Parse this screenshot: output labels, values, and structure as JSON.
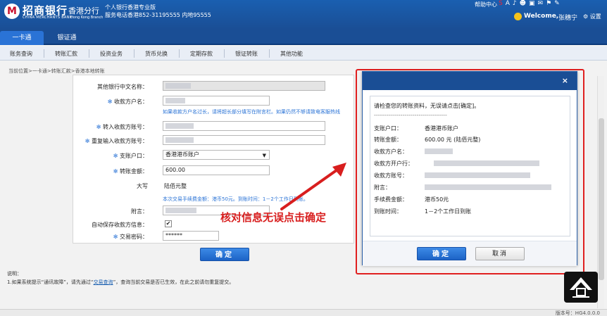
{
  "header": {
    "logo_glyph": "M",
    "bank_name": "招商银行",
    "branch": "香港分行",
    "bank_en": "CHINA MERCHANTS BANK",
    "branch_en": "Hong Kong Branch",
    "product": "个人银行香港专业版",
    "hotline": "服务电话香港852-31195555 内地95555",
    "help": "帮助中心",
    "tool_icons": [
      "S",
      "A",
      "♪",
      "☻",
      "▣",
      "✉",
      "⚑",
      "✎"
    ],
    "welcome": "Welcome,",
    "username": "张穗宁",
    "settings": "⚙ 设置"
  },
  "nav": {
    "tabs": [
      {
        "label": "一卡通",
        "active": true
      },
      {
        "label": "银证通",
        "active": false
      }
    ]
  },
  "subnav": {
    "items": [
      "账务查询",
      "转账汇款",
      "投资业务",
      "货币兑换",
      "定期存款",
      "银证转账",
      "其他功能"
    ]
  },
  "breadcrumb": "当前位置>一卡通>转账汇款>香港本地转账",
  "form": {
    "other_bank_name_label": "其他银行中文名称：",
    "payee_name_label": "收款方户名：",
    "payee_hint": "如果收款方户名过长，请将超长部分填写在附言栏。如果仍然不够请致电客服热线",
    "payee_account_label": "转入收款方账号：",
    "repeat_account_label": "重复输入收款方账号：",
    "from_account_label": "支账户口：",
    "from_account_value": "香港港币账户",
    "amount_label": "转账金额：",
    "amount_value": "600.00",
    "uppercase_label": "大写",
    "uppercase_value": "陆佰元整",
    "fee_hint": "本次交易手续费金额：港币50元。到账时间：1－2个工作日到账。",
    "remark_label": "附言：",
    "autosave_label": "自动保存收款方信息：",
    "autosave_checked": "✔",
    "password_label": "交易密码：",
    "password_value": "******",
    "confirm_button": "确定"
  },
  "notes": {
    "title": "说明：",
    "line_prefix": "1.如果系统提示“通讯故障”，请先通过“",
    "link": "交易查询",
    "line_suffix": "”，查询当前交易是否已生效，在此之前请勿重复提交。"
  },
  "dialog": {
    "close": "×",
    "intro": "请检查您的转账资料，无误请点击[确定]。",
    "divider": "------------------------------------",
    "rows": [
      {
        "label": "支账户口：",
        "value": "香港港币账户"
      },
      {
        "label": "转账金额：",
        "value": "600.00 元 (陆佰元整)"
      },
      {
        "label": "收款方户名：",
        "value": ""
      },
      {
        "label": "收款方开户行：",
        "value": ""
      },
      {
        "label": "收款方账号：",
        "value": ""
      },
      {
        "label": "附言：",
        "value": ""
      },
      {
        "label": "手续费金额：",
        "value": "港币50元"
      },
      {
        "label": "到账时间：",
        "value": "1－2个工作日到账"
      }
    ],
    "confirm_button": "确定",
    "cancel_button": "取消"
  },
  "annotation": "核对信息无误点击确定",
  "footer": {
    "version": "版本号：HG4.0.0.0"
  }
}
